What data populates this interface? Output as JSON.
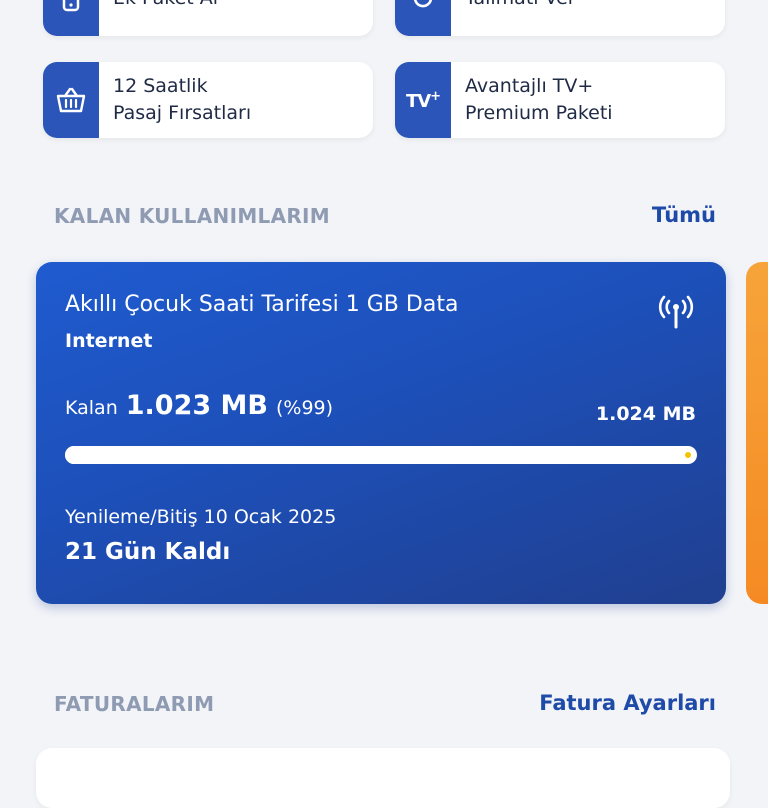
{
  "quick_actions": [
    {
      "label": "Ek Paket Al",
      "icon": "phone-plus-icon"
    },
    {
      "label": "Talimatı Ver",
      "icon": "refresh-icon"
    },
    {
      "label": "12 Saatlik\nPasaj Fırsatları",
      "icon": "basket-icon"
    },
    {
      "label": "Avantajlı TV+\nPremium Paketi",
      "icon": "tvplus-icon",
      "icon_text": "TV",
      "icon_sup": "+"
    }
  ],
  "usage_section": {
    "title": "KALAN KULLANIMLARIM",
    "link": "Tümü",
    "card": {
      "plan_name": "Akıllı Çocuk Saati Tarifesi 1 GB Data",
      "type": "Internet",
      "remaining_label": "Kalan",
      "remaining_value": "1.023 MB",
      "remaining_percent": "(%99)",
      "total": "1.024 MB",
      "progress_fraction": 0.99,
      "renewal": "Yenileme/Bitiş 10 Ocak 2025",
      "days_left": "21 Gün Kaldı",
      "accent": "#2b55b9"
    }
  },
  "bills_section": {
    "title": "FATURALARIM",
    "link": "Fatura Ayarları"
  },
  "colors": {
    "primary": "#1e4aa8",
    "card_gradient_start": "#1f5bd0",
    "card_gradient_end": "#203f8f",
    "secondary_card": "#f58a23",
    "progress_marker": "#f5c400"
  }
}
